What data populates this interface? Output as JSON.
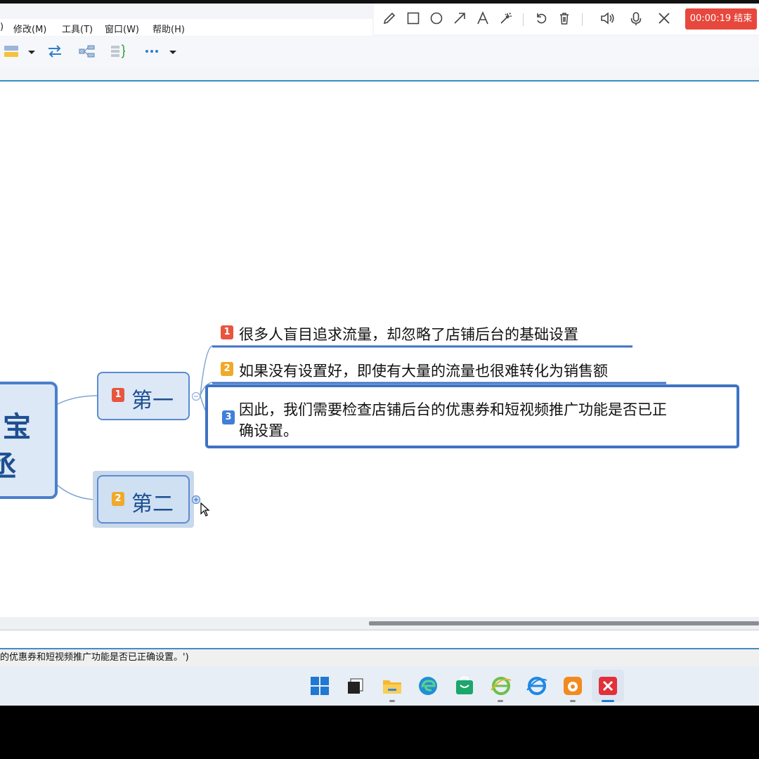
{
  "menu": {
    "partial": ")",
    "modify": "修改(M)",
    "tools": "工具(T)",
    "window": "窗口(W)",
    "help": "帮助(H)"
  },
  "toolbar": {
    "icons": [
      "topic-icon",
      "swap-icon",
      "structure-icon",
      "summary-icon",
      "more-icon"
    ]
  },
  "recorder": {
    "tools": [
      "pencil-icon",
      "rectangle-icon",
      "circle-icon",
      "arrow-icon",
      "text-icon",
      "magic-icon",
      "undo-icon",
      "delete-icon",
      "speaker-icon",
      "mic-icon",
      "close-icon"
    ],
    "timer": "00:00:19 结束",
    "timer_color": "#e8473d"
  },
  "mindmap": {
    "central": {
      "line1": "宝",
      "line2": "丞"
    },
    "branch1": {
      "badge": "1",
      "label": "第一",
      "badge_color": "#e8553f"
    },
    "branch2": {
      "badge": "2",
      "label": "第二",
      "badge_color": "#f0a92a"
    },
    "children": [
      {
        "badge": "1",
        "text": "很多人盲目追求流量，却忽略了店铺后台的基础设置",
        "badge_color": "#e8553f"
      },
      {
        "badge": "2",
        "text": "如果没有设置好，即使有大量的流量也很难转化为销售额",
        "badge_color": "#f0a92a"
      },
      {
        "badge": "3",
        "line1": "因此，我们需要检查店铺后台的优惠券和短视频推广功能是否已正",
        "line2": "确设置。",
        "badge_color": "#3f7fd9"
      }
    ]
  },
  "status_bar": {
    "text": "的优惠券和短视频推广功能是否已正确设置。')"
  },
  "taskbar": {
    "apps": [
      "windows-start-icon",
      "task-view-icon",
      "file-explorer-icon",
      "edge-icon",
      "store-icon",
      "ie-green-icon",
      "ie-blue-icon",
      "uc-browser-icon",
      "xmind-icon"
    ]
  }
}
